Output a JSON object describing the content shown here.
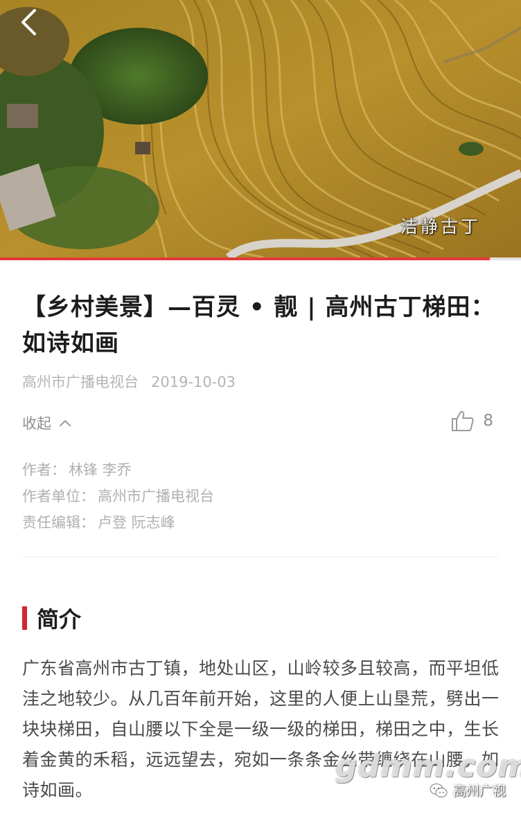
{
  "video": {
    "caption": "洁静古丁",
    "progress": 0.94,
    "progress_color": "#e5383b"
  },
  "nav": {
    "back_icon": "chevron-left-icon"
  },
  "article": {
    "title": "【乡村美景】—百灵 • 靓 | 高州古丁梯田：如诗如画",
    "source": "高州市广播电视台",
    "date": "2019-10-03",
    "collapse_label": "收起",
    "like_count": "8",
    "credits": {
      "author_label": "作者：",
      "author_value": "林锋 李乔",
      "unit_label": "作者单位：",
      "unit_value": "高州市广播电视台",
      "editor_label": "责任编辑：",
      "editor_value": "卢登 阮志峰"
    }
  },
  "intro": {
    "heading": "简介",
    "accent_color": "#d3262c",
    "paragraph": "广东省高州市古丁镇，地处山区，山岭较多且较高，而平坦低洼之地较少。从几百年前开始，这里的人便上山垦荒，劈出一块块梯田，自山腰以下全是一级一级的梯田，梯田之中，生长着金黄的禾稻，远远望去，宛如一条条金丝带缠绕在山腰，如诗如画。"
  },
  "watermarks": {
    "site": "gdmm.com",
    "account": "高州广视"
  }
}
